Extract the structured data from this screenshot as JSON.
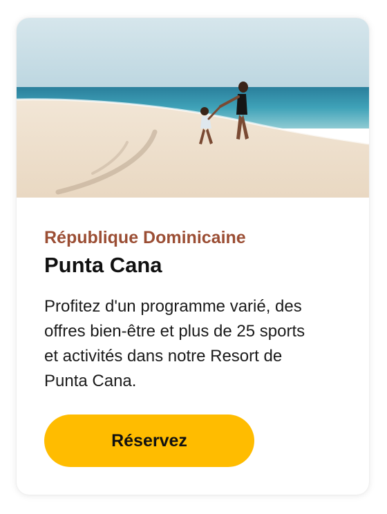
{
  "card": {
    "image": {
      "semantic": "beach-photo",
      "colors": {
        "sky": "#c7dde6",
        "sea": "#2f93ad",
        "sand": "#efe0cc"
      }
    },
    "eyebrow": "République Dominicaine",
    "eyebrow_color": "#9b4e34",
    "title": "Punta Cana",
    "description": "Profitez d'un programme varié, des offres bien-être et plus de 25 sports et activités dans notre Resort de Punta Cana.",
    "cta": {
      "label": "Réservez",
      "color": "#ffbc00"
    }
  }
}
